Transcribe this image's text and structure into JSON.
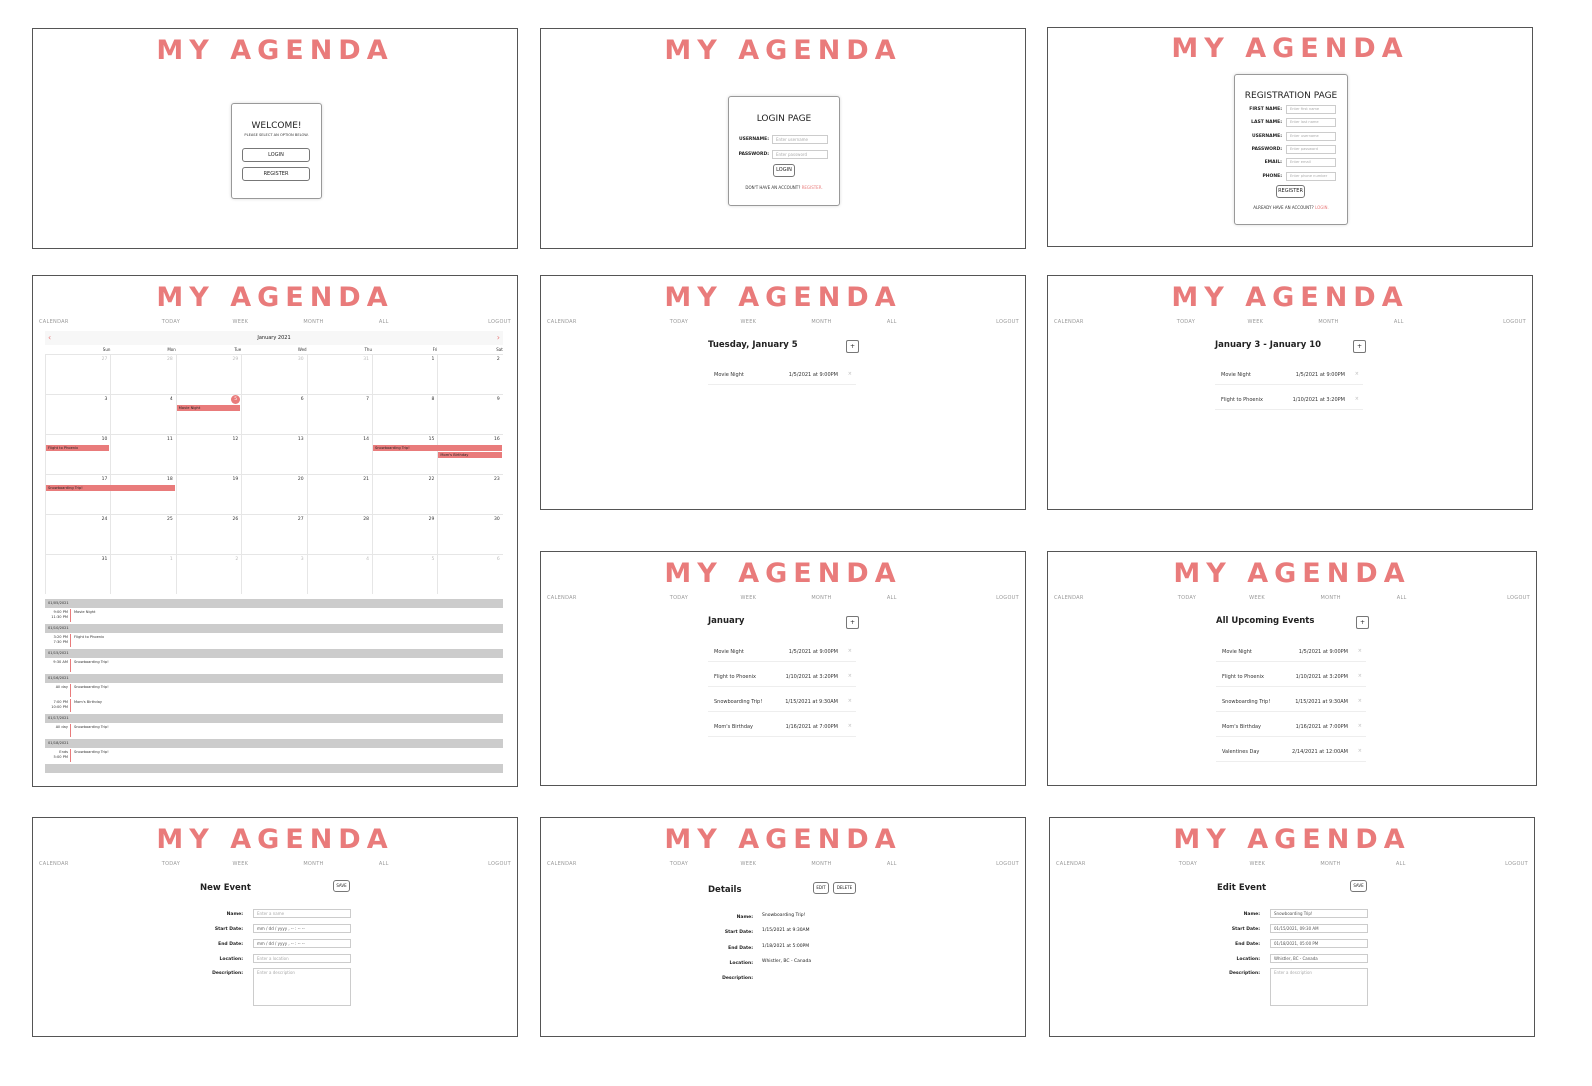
{
  "brand": "MY AGENDA",
  "nav": [
    "CALENDAR",
    "TODAY",
    "WEEK",
    "MONTH",
    "ALL",
    "LOGOUT"
  ],
  "welcome": {
    "title": "WELCOME!",
    "subtitle": "PLEASE SELECT AN OPTION BELOW.",
    "login": "LOGIN",
    "register": "REGISTER"
  },
  "login": {
    "title": "LOGIN PAGE",
    "username_label": "USERNAME:",
    "username_ph": "Enter username",
    "password_label": "PASSWORD:",
    "password_ph": "Enter password",
    "button": "LOGIN",
    "footer": "DON'T HAVE AN ACCOUNT?",
    "footer_link": "REGISTER."
  },
  "register": {
    "title": "REGISTRATION PAGE",
    "fields": [
      {
        "label": "FIRST NAME:",
        "ph": "Enter first name"
      },
      {
        "label": "LAST NAME:",
        "ph": "Enter last name"
      },
      {
        "label": "USERNAME:",
        "ph": "Enter username"
      },
      {
        "label": "PASSWORD:",
        "ph": "Enter password"
      },
      {
        "label": "EMAIL:",
        "ph": "Enter email"
      },
      {
        "label": "PHONE:",
        "ph": "Enter phone number"
      }
    ],
    "button": "REGISTER",
    "footer": "ALREADY HAVE AN ACCOUNT?",
    "footer_link": "LOGIN."
  },
  "calendar": {
    "month": "January 2021",
    "prev": "‹",
    "next": "›",
    "dow": [
      "Sun",
      "Mon",
      "Tue",
      "Wed",
      "Thu",
      "Fri",
      "Sat"
    ],
    "days": [
      "27",
      "28",
      "29",
      "30",
      "31",
      "1",
      "2",
      "3",
      "4",
      "5",
      "6",
      "7",
      "8",
      "9",
      "10",
      "11",
      "12",
      "13",
      "14",
      "15",
      "16",
      "17",
      "18",
      "19",
      "20",
      "21",
      "22",
      "23",
      "24",
      "25",
      "26",
      "27",
      "28",
      "29",
      "30",
      "31",
      "1",
      "2",
      "3",
      "4",
      "5",
      "6"
    ],
    "events": [
      "Movie Night",
      "Flight to Phoenix",
      "Snowboarding Trip!",
      "Mom's Birthday",
      "Snowboarding Trip!"
    ],
    "list": [
      {
        "date": "01/05/2021",
        "rows": [
          {
            "time": "9:00 PM",
            "time2": "11:30 PM",
            "title": "Movie Night"
          }
        ]
      },
      {
        "date": "01/10/2021",
        "rows": [
          {
            "time": "3:20 PM",
            "time2": "7:30 PM",
            "title": "Flight to Phoenix"
          }
        ]
      },
      {
        "date": "01/15/2021",
        "rows": [
          {
            "time": "9:30 AM",
            "time2": "",
            "title": "Snowboarding Trip!"
          }
        ]
      },
      {
        "date": "01/16/2021",
        "rows": [
          {
            "time": "All day",
            "time2": "",
            "title": "Snowboarding Trip!"
          },
          {
            "time": "7:00 PM",
            "time2": "10:00 PM",
            "title": "Mom's Birthday"
          }
        ]
      },
      {
        "date": "01/17/2021",
        "rows": [
          {
            "time": "All day",
            "time2": "",
            "title": "Snowboarding Trip!"
          }
        ]
      },
      {
        "date": "01/18/2021",
        "rows": [
          {
            "time": "Ends",
            "time2": "5:00 PM",
            "title": "Snowboarding Trip!"
          }
        ]
      }
    ]
  },
  "today_view": {
    "title": "Tuesday, January 5",
    "plus": "+",
    "events": [
      {
        "name": "Movie Night",
        "date": "1/5/2021  at  9:00PM"
      }
    ]
  },
  "week_view": {
    "title": "January 3 - January 10",
    "plus": "+",
    "events": [
      {
        "name": "Movie Night",
        "date": "1/5/2021  at  9:00PM"
      },
      {
        "name": "Flight to Phoenix",
        "date": "1/10/2021  at  3:20PM"
      }
    ]
  },
  "month_view": {
    "title": "January",
    "plus": "+",
    "events": [
      {
        "name": "Movie Night",
        "date": "1/5/2021  at  9:00PM"
      },
      {
        "name": "Flight to Phoenix",
        "date": "1/10/2021  at  3:20PM"
      },
      {
        "name": "Snowboarding Trip!",
        "date": "1/15/2021  at  9:30AM"
      },
      {
        "name": "Mom's Birthday",
        "date": "1/16/2021  at  7:00PM"
      }
    ]
  },
  "all_view": {
    "title": "All Upcoming Events",
    "plus": "+",
    "events": [
      {
        "name": "Movie Night",
        "date": "1/5/2021  at  9:00PM"
      },
      {
        "name": "Flight to Phoenix",
        "date": "1/10/2021  at  3:20PM"
      },
      {
        "name": "Snowboarding Trip!",
        "date": "1/15/2021  at  9:30AM"
      },
      {
        "name": "Mom's Birthday",
        "date": "1/16/2021  at  7:00PM"
      },
      {
        "name": "Valentines Day",
        "date": "2/14/2021  at  12:00AM"
      }
    ]
  },
  "new_event": {
    "title": "New Event",
    "save": "SAVE",
    "labels": [
      "Name:",
      "Start Date:",
      "End Date:",
      "Location:",
      "Description:"
    ],
    "name_ph": "Enter a name",
    "date_ph": "mm / dd / yyyy , -- : -- --",
    "location_ph": "Enter a location",
    "desc_ph": "Enter a description"
  },
  "details": {
    "title": "Details",
    "edit": "EDIT",
    "delete": "DELETE",
    "labels": [
      "Name:",
      "Start Date:",
      "End Date:",
      "Location:",
      "Description:"
    ],
    "values": [
      "Snowboarding Trip!",
      "1/15/2021 at 9:30AM",
      "1/18/2021 at 5:00PM",
      "Whistler, BC - Canada",
      ""
    ]
  },
  "edit_event": {
    "title": "Edit Event",
    "save": "SAVE",
    "labels": [
      "Name:",
      "Start Date:",
      "End Date:",
      "Location:",
      "Description:"
    ],
    "values": [
      "Snowboarding Trip!",
      "01/15/2021, 09:30 AM",
      "01/18/2021, 05:00 PM",
      "Whistler, BC - Canada"
    ],
    "desc_ph": "Enter a description"
  },
  "colors": {
    "accent": "#e97b7b",
    "border": "#555555",
    "grey_bar": "#cccccc"
  }
}
